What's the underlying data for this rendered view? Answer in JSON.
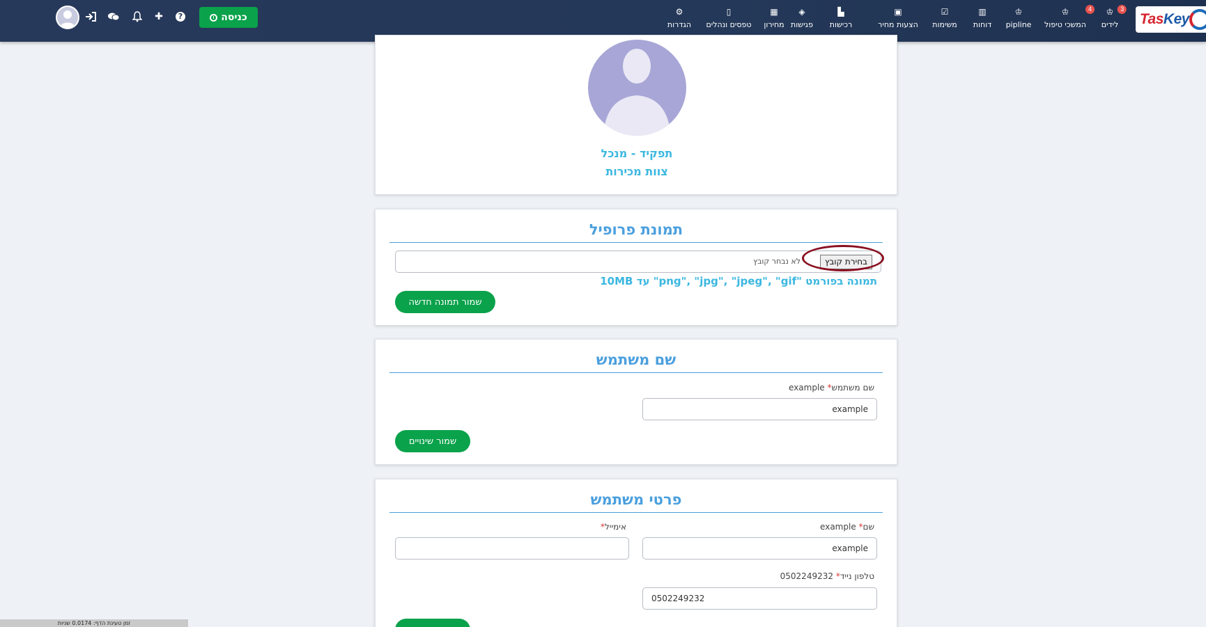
{
  "nav": {
    "logo_text": "TasKey",
    "items": [
      {
        "label": "לידים",
        "icon": "award-icon",
        "glyph": "♔",
        "badge": "3"
      },
      {
        "label": "המשכי טיפול",
        "icon": "award-icon",
        "glyph": "♔",
        "badge": "4"
      },
      {
        "label": "pipline",
        "icon": "award-icon",
        "glyph": "♔",
        "badge": ""
      },
      {
        "label": "דוחות",
        "icon": "bar-chart-icon",
        "glyph": "▥",
        "badge": ""
      },
      {
        "label": "משימות",
        "icon": "checkbox-icon",
        "glyph": "☑",
        "badge": ""
      },
      {
        "label": "הצעות מחיר",
        "icon": "document-icon",
        "glyph": "▣",
        "badge": ""
      },
      {
        "label": "רכישות",
        "icon": "building-icon",
        "glyph": "▙",
        "badge": ""
      },
      {
        "label": "פגישות",
        "icon": "handshake-icon",
        "glyph": "◈",
        "badge": ""
      },
      {
        "label": "מחירון",
        "icon": "barcode-icon",
        "glyph": "▦",
        "badge": ""
      },
      {
        "label": "טפסים ונהלים",
        "icon": "form-icon",
        "glyph": "▯",
        "badge": ""
      },
      {
        "label": "הגדרות",
        "icon": "gear-icon",
        "glyph": "⚙",
        "badge": ""
      }
    ],
    "entry_button": "כניסה",
    "help_glyph": "?",
    "plus_glyph": "✚",
    "bell_glyph": "♫",
    "chat_glyph": "✉",
    "login_glyph": "➔"
  },
  "profile": {
    "role": "תפקיד - מנכל",
    "team": "צוות מכירות"
  },
  "photo_card": {
    "title": "תמונת פרופיל",
    "file_button": "בחירת קובץ",
    "file_status": "לא נבחר קובץ",
    "format_note": "תמונה בפורמט \"png\", \"jpg\", \"jpeg\", \"gif\" עד 10MB",
    "save_button": "שמור תמונה חדשה"
  },
  "username_card": {
    "title": "שם משתמש",
    "label": "שם משתמש",
    "label_value": "example",
    "input_value": "example",
    "save_button": "שמור שינויים"
  },
  "details_card": {
    "title": "פרטי משתמש",
    "name_label": "שם",
    "name_label_value": "example",
    "name_value": "example",
    "email_label": "אימייל",
    "email_value": "",
    "phone_label": "טלפון נייד",
    "phone_label_value": "0502249232",
    "phone_value": "0502249232"
  },
  "footer": {
    "load_time": "זמן טעינת הדף: 0.0174 שניות"
  }
}
